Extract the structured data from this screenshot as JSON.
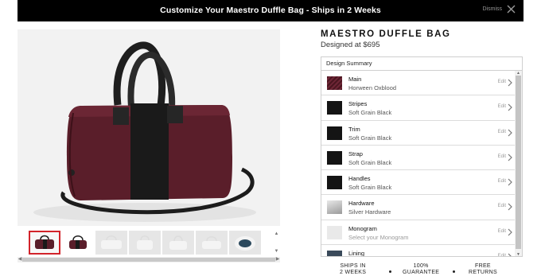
{
  "banner": {
    "text": "Customize Your Maestro Duffle Bag - Ships in 2 Weeks",
    "dismiss_label": "Dismiss"
  },
  "product": {
    "title": "MAESTRO DUFFLE BAG",
    "price_line": "Designed at $695"
  },
  "gallery": {
    "thumbnail_count": 7,
    "selected_index": 0
  },
  "summary": {
    "header": "Design Summary",
    "edit_label": "Edit",
    "items": [
      {
        "title": "Main",
        "value": "Horween Oxblood",
        "swatch": "#5a1e2a"
      },
      {
        "title": "Stripes",
        "value": "Soft Grain Black",
        "swatch": "#141414"
      },
      {
        "title": "Trim",
        "value": "Soft Grain Black",
        "swatch": "#141414"
      },
      {
        "title": "Strap",
        "value": "Soft Grain Black",
        "swatch": "#141414"
      },
      {
        "title": "Handles",
        "value": "Soft Grain Black",
        "swatch": "#141414"
      },
      {
        "title": "Hardware",
        "value": "Silver Hardware",
        "swatch": "#b5b5b5"
      },
      {
        "title": "Monogram",
        "value": "Select your Monogram",
        "swatch": "#e9e9e9"
      },
      {
        "title": "Lining",
        "value": "",
        "swatch": "#3a4a5a"
      }
    ]
  },
  "perks": [
    {
      "line1": "SHIPS IN",
      "line2": "2 WEEKS"
    },
    {
      "line1": "100%",
      "line2": "GUARANTEE"
    },
    {
      "line1": "FREE",
      "line2": "RETURNS"
    }
  ],
  "colors": {
    "banner_bg": "#000000",
    "selected_thumb_border": "#d2232a",
    "bag_body": "#5a1e2a",
    "bag_stripe": "#1a1a1a"
  }
}
